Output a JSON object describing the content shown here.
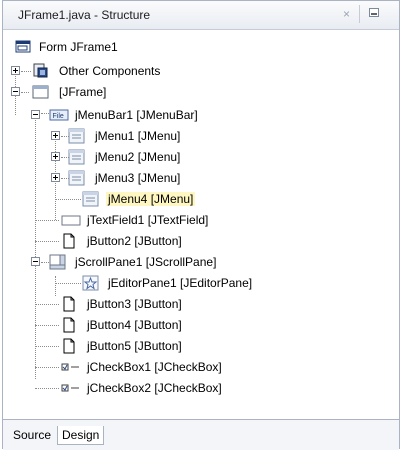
{
  "window": {
    "title": "JFrame1.java - Structure",
    "close_glyph": "×"
  },
  "tree": {
    "root_label": "Form JFrame1",
    "other_components": "Other Components",
    "jframe": "[JFrame]",
    "menubar": "jMenuBar1 [JMenuBar]",
    "menubar_icon_text": "File",
    "menu1": "jMenu1 [JMenu]",
    "menu2": "jMenu2 [JMenu]",
    "menu3": "jMenu3 [JMenu]",
    "menu4": "jMenu4 [JMenu]",
    "textfield": "jTextField1 [JTextField]",
    "button2": "jButton2 [JButton]",
    "scrollpane": "jScrollPane1 [JScrollPane]",
    "editorpane": "jEditorPane1 [JEditorPane]",
    "button3": "jButton3 [JButton]",
    "button4": "jButton4 [JButton]",
    "button5": "jButton5 [JButton]",
    "checkbox1": "jCheckBox1 [JCheckBox]",
    "checkbox2": "jCheckBox2 [JCheckBox]",
    "selected_item": "jMenu4 [JMenu]"
  },
  "tabs": {
    "source": "Source",
    "design": "Design",
    "active": "Design"
  },
  "colors": {
    "selection_highlight": "#fff7c2",
    "border": "#a9b3c2"
  }
}
